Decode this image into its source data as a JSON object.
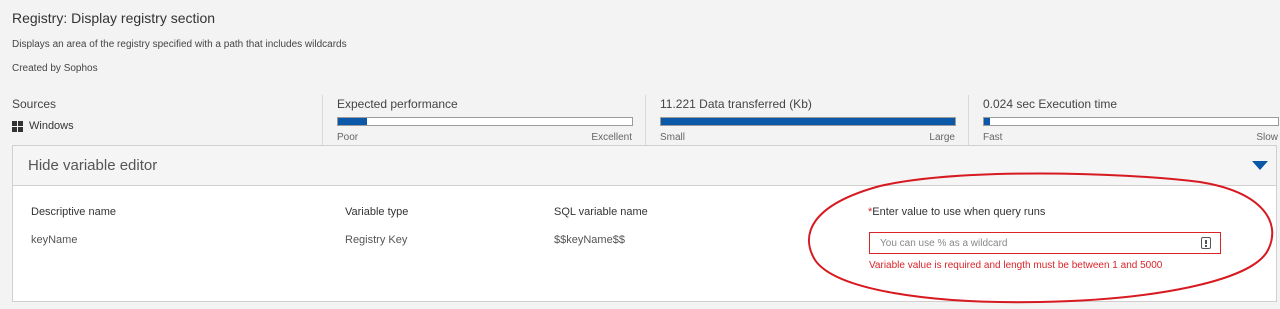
{
  "header": {
    "title": "Registry: Display registry section",
    "description": "Displays an area of the registry specified with a path that includes wildcards",
    "creator": "Created by Sophos"
  },
  "metrics": {
    "sources": {
      "label": "Sources",
      "os": "Windows",
      "icon": "windows-icon"
    },
    "performance": {
      "label": "Expected performance",
      "low": "Poor",
      "high": "Excellent",
      "level": 0.1
    },
    "data": {
      "label": "11.221 Data transferred (Kb)",
      "low": "Small",
      "high": "Large",
      "level": 1.0
    },
    "time": {
      "label": "0.024 sec Execution time",
      "low": "Fast",
      "high": "Slow",
      "level": 0.02
    }
  },
  "editor": {
    "toggle_label": "Hide variable editor",
    "columns": {
      "name": "Descriptive name",
      "type": "Variable type",
      "sql": "SQL variable name",
      "value": "Enter value to use when query runs"
    },
    "row": {
      "name": "keyName",
      "type": "Registry Key",
      "sql": "$$keyName$$",
      "value": "",
      "placeholder": "You can use % as a wildcard"
    },
    "required_marker": "*",
    "error": "Variable value is required and length must be between 1 and 5000"
  },
  "colors": {
    "accent": "#0b58a8",
    "error": "#d9252a",
    "annotation": "#d71920"
  }
}
